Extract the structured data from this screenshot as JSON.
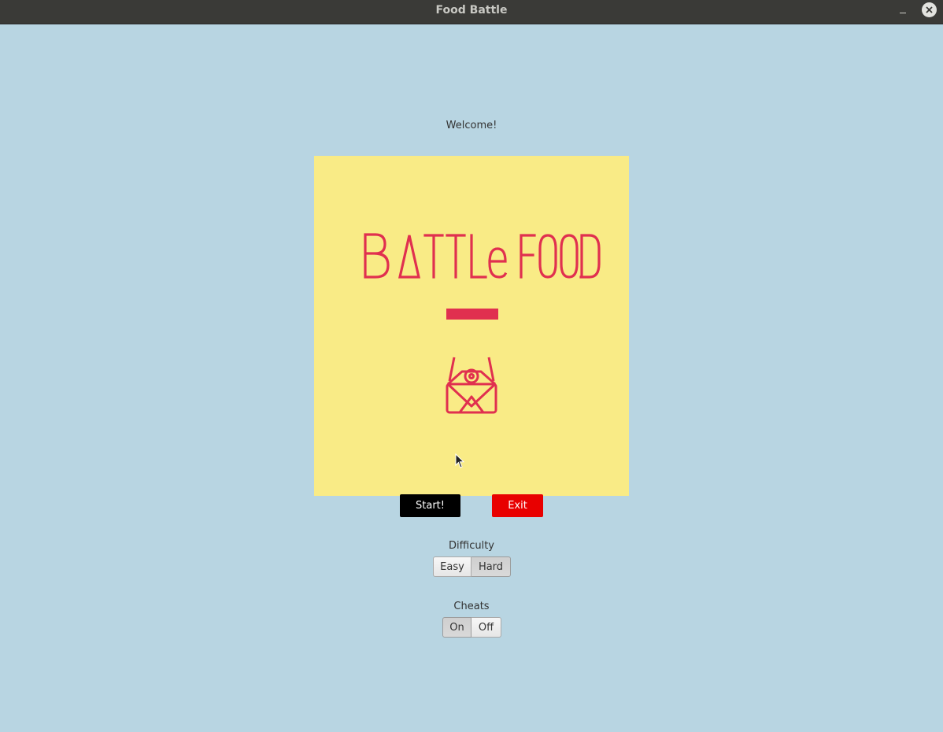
{
  "window": {
    "title": "Food Battle"
  },
  "main": {
    "welcome_text": "Welcome!",
    "splash": {
      "logo_text": "BattleFood",
      "colors": {
        "background": "#f9eb86",
        "accent": "#e0304f"
      }
    },
    "buttons": {
      "start_label": "Start!",
      "exit_label": "Exit"
    },
    "difficulty": {
      "label": "Difficulty",
      "options": [
        "Easy",
        "Hard"
      ],
      "selected": "Hard"
    },
    "cheats": {
      "label": "Cheats",
      "options": [
        "On",
        "Off"
      ],
      "selected": "On"
    }
  },
  "colors": {
    "window_background": "#b8d5e2",
    "start_button": "#000000",
    "exit_button": "#e80000",
    "titlebar": "#3a3a37"
  },
  "icons": {
    "close": "close-icon",
    "minimize": "minimize-icon",
    "mascot": "robot-mascot-icon"
  }
}
